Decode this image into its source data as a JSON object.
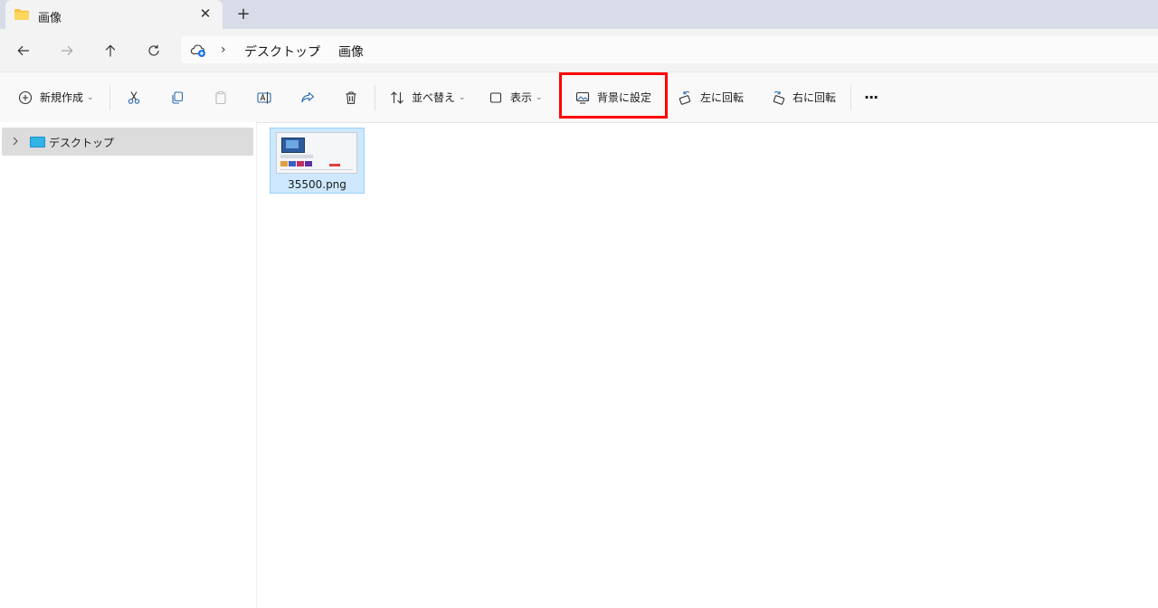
{
  "tab": {
    "title": "画像",
    "close_glyph": "✕",
    "new_tab_glyph": "+"
  },
  "nav": {
    "back_icon": "arrow-left-icon",
    "forward_icon": "arrow-right-icon",
    "up_icon": "arrow-up-icon",
    "refresh_icon": "refresh-icon"
  },
  "address": {
    "location_icon": "onedrive-cloud-icon",
    "separator": "›",
    "crumbs": [
      "デスクトップ",
      "画像"
    ]
  },
  "commands": {
    "new": "新規作成",
    "sort": "並べ替え",
    "view": "表示",
    "set_background": "背景に設定",
    "rotate_left": "左に回転",
    "rotate_right": "右に回転",
    "more": "···",
    "dropdown_glyph": "⌄"
  },
  "tree": {
    "items": [
      {
        "label": "デスクトップ"
      }
    ]
  },
  "files": [
    {
      "name": "35500.png",
      "selected": true
    }
  ],
  "colors": {
    "highlight": "#ff0000",
    "selection_bg": "#cde8ff",
    "selection_border": "#99d1ff",
    "folder": "#f6c344"
  }
}
